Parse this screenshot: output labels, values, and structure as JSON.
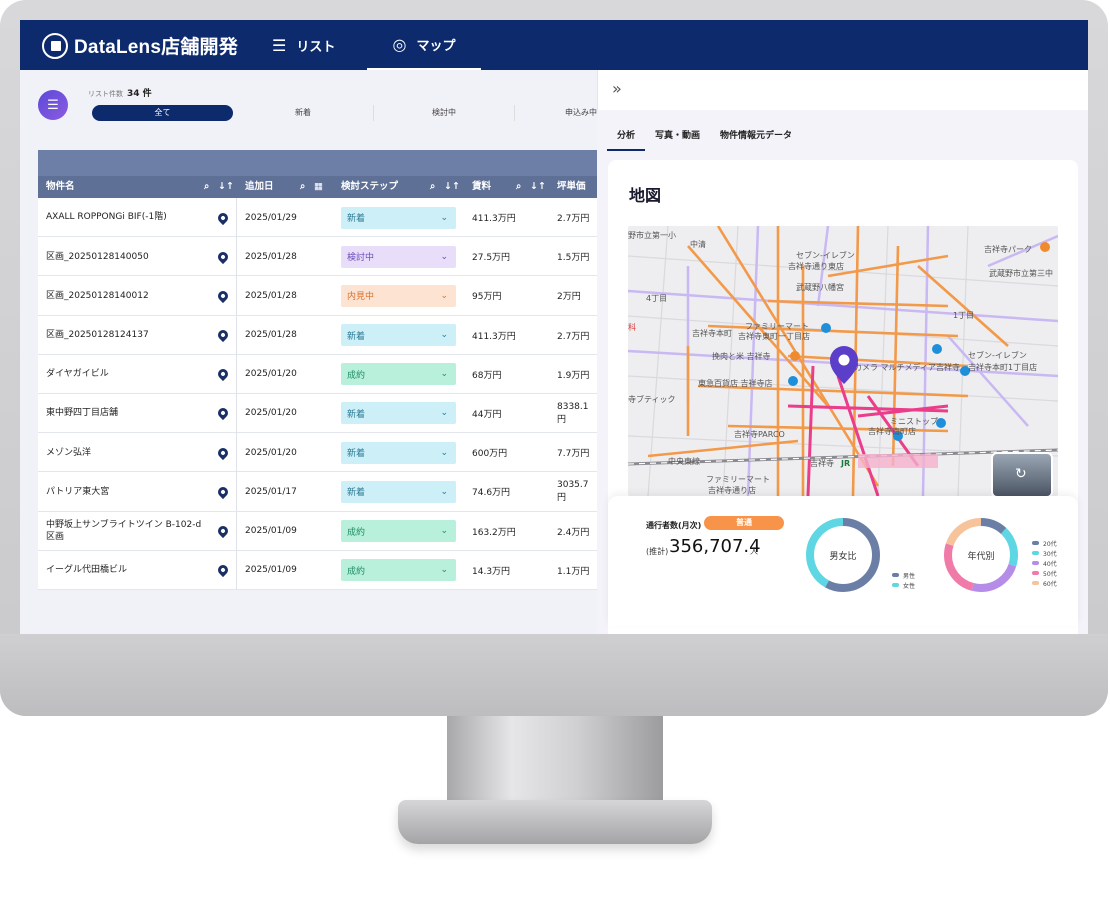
{
  "app": {
    "name": "DataLens店舗開発"
  },
  "nav": {
    "tabs": [
      {
        "label": "リスト",
        "icon": "list-icon"
      },
      {
        "label": "マップ",
        "icon": "map-pin-icon",
        "active": true
      }
    ]
  },
  "list": {
    "count_label": "リスト件数",
    "count_value": "34 件",
    "filters": [
      "全て",
      "新着",
      "検討中",
      "申込み中"
    ],
    "columns": [
      "物件名",
      "追加日",
      "検討ステップ",
      "賃料",
      "坪単価"
    ],
    "rows": [
      {
        "name": "AXALL ROPPONGi BIF(-1階)",
        "date": "2025/01/29",
        "step": "新着",
        "rent": "411.3万円",
        "tsubo": "2.7万円"
      },
      {
        "name": "区画_20250128140050",
        "date": "2025/01/28",
        "step": "検討中",
        "rent": "27.5万円",
        "tsubo": "1.5万円"
      },
      {
        "name": "区画_20250128140012",
        "date": "2025/01/28",
        "step": "内見中",
        "rent": "95万円",
        "tsubo": "2万円"
      },
      {
        "name": "区画_20250128124137",
        "date": "2025/01/28",
        "step": "新着",
        "rent": "411.3万円",
        "tsubo": "2.7万円"
      },
      {
        "name": "ダイヤガイビル",
        "date": "2025/01/20",
        "step": "成約",
        "rent": "68万円",
        "tsubo": "1.9万円"
      },
      {
        "name": "東中野四丁目店舗",
        "date": "2025/01/20",
        "step": "新着",
        "rent": "44万円",
        "tsubo": "8338.1円"
      },
      {
        "name": "メゾン弘洋",
        "date": "2025/01/20",
        "step": "新着",
        "rent": "600万円",
        "tsubo": "7.7万円"
      },
      {
        "name": "パトリア東大宮",
        "date": "2025/01/17",
        "step": "新着",
        "rent": "74.6万円",
        "tsubo": "3035.7円"
      },
      {
        "name": "中野坂上サンブライトツイン B-102-d 区画",
        "date": "2025/01/09",
        "step": "成約",
        "rent": "163.2万円",
        "tsubo": "2.4万円"
      },
      {
        "name": "イーグル代田橋ビル",
        "date": "2025/01/09",
        "step": "成約",
        "rent": "14.3万円",
        "tsubo": "1.1万円"
      }
    ],
    "step_colors": {
      "新着": {
        "bg": "#cdeff7",
        "fg": "#2a7a95"
      },
      "検討中": {
        "bg": "#e8defa",
        "fg": "#6c4bb6"
      },
      "内見中": {
        "bg": "#fde3d2",
        "fg": "#d8722e"
      },
      "成約": {
        "bg": "#b8f0dc",
        "fg": "#1f8c63"
      }
    }
  },
  "panel": {
    "tabs": [
      "分析",
      "写真・動画",
      "物件情報元データ"
    ],
    "map_title": "地図",
    "map_labels": [
      "野市立第一小",
      "中清",
      "セブン-イレブン",
      "吉祥寺通り東店",
      "吉祥寺パーク",
      "武蔵野市立第三中",
      "4丁目",
      "武蔵野八幡宮",
      "1丁目",
      "吉祥寺本町",
      "ファミリーマート",
      "吉祥寺東町一丁目店",
      "挽肉と米 吉祥寺",
      "セブン-イレブン",
      "吉祥寺本町1丁目店",
      "パシカメラ マルチメディア吉祥寺",
      "東急百貨店 吉祥寺店",
      "寺ブティック",
      "吉祥寺PARCO",
      "ミニストップ",
      "吉祥寺南町店",
      "中央東線",
      "吉祥寺",
      "JR",
      "ファミリーマート",
      "吉祥寺通り店",
      "科"
    ],
    "traffic": {
      "label": "通行者数(月次)",
      "badge": "普通",
      "estimate_label": "(推計)",
      "value": "356,707.4",
      "unit": "人"
    },
    "gender": {
      "title": "男女比",
      "legend": [
        "男性",
        "女性"
      ],
      "values": [
        0.58,
        0.42
      ],
      "colors": [
        "#6b7fa6",
        "#5fd6e3"
      ]
    },
    "age": {
      "title": "年代別",
      "legend": [
        "20代",
        "30代",
        "40代",
        "50代",
        "60代"
      ],
      "values": [
        0.12,
        0.18,
        0.24,
        0.26,
        0.2
      ],
      "colors": [
        "#6b7fa6",
        "#5fd6e3",
        "#b58de8",
        "#f07aa8",
        "#f7c39a"
      ]
    }
  }
}
